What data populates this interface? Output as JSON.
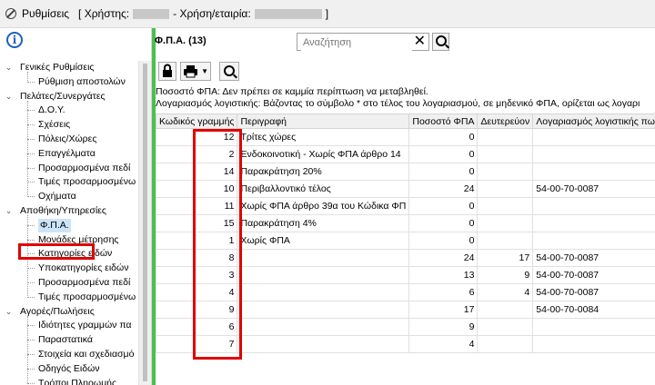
{
  "window": {
    "title": "Ρυθμίσεις",
    "user_label": "[ Χρήστης:",
    "company_label": "- Χρήση/εταιρία:",
    "close_bracket": "]"
  },
  "tree": {
    "groups": [
      {
        "label": "Γενικές Ρυθμίσεις",
        "children": [
          "Ρύθμιση αποστολών"
        ]
      },
      {
        "label": "Πελάτες/Συνεργάτες",
        "children": [
          "Δ.Ο.Υ.",
          "Σχέσεις",
          "Πόλεις/Χώρες",
          "Επαγγέλματα",
          "Προσαρμοσμένα πεδί",
          "Τιμές προσαρμοσμένω",
          "Οχήματα"
        ]
      },
      {
        "label": "Αποθήκη/Υπηρεσίες",
        "children": [
          "Φ.Π.Α.",
          "Μονάδες μέτρησης",
          "Κατηγορίες ειδών",
          "Υποκατηγορίες ειδών",
          "Προσαρμοσμένα πεδί",
          "Τιμές προσαρμοσμένω"
        ]
      },
      {
        "label": "Αγορές/Πωλήσεις",
        "children": [
          "Ιδιότητες γραμμών πα",
          "Παραστατικά",
          "Στοιχεία και σχεδιασμό",
          "Οδηγός Ειδών",
          "Τρόποι Πληρωμής"
        ]
      }
    ],
    "selected": "Φ.Π.Α."
  },
  "main": {
    "heading": "Φ.Π.Α. (13)",
    "search_placeholder": "Αναζήτηση",
    "notes": [
      "Ποσοστό ΦΠΑ: Δεν πρέπει σε καμμία περίπτωση να μεταβληθεί.",
      "Λογαριασμός λογιστικής: Βάζοντας το σύμβολο * στο τέλος του λογαριασμού, σε μηδενικό ΦΠΑ, ορίζεται ως λογαρι"
    ],
    "columns": [
      "Κωδικός γραμμής",
      "Περιγραφή",
      "Ποσοστό ΦΠΑ",
      "Δευτερεύον",
      "Λογαριασμός λογιστικής πω"
    ],
    "rows": [
      {
        "code": "12",
        "desc": "Τρίτες χώρες",
        "pct": "0",
        "sec": "",
        "acct": ""
      },
      {
        "code": "2",
        "desc": "Ενδοκοινοτική - Χωρίς ΦΠΑ άρθρο 14",
        "pct": "0",
        "sec": "",
        "acct": ""
      },
      {
        "code": "14",
        "desc": "Παρακράτηση 20%",
        "pct": "0",
        "sec": "",
        "acct": ""
      },
      {
        "code": "10",
        "desc": "Περιβαλλοντικό τέλος",
        "pct": "24",
        "sec": "",
        "acct": "54-00-70-0087"
      },
      {
        "code": "11",
        "desc": "Χωρίς ΦΠΑ άρθρο 39α του Κώδικα ΦΠ",
        "pct": "0",
        "sec": "",
        "acct": ""
      },
      {
        "code": "15",
        "desc": "Παρακράτηση 4%",
        "pct": "0",
        "sec": "",
        "acct": ""
      },
      {
        "code": "1",
        "desc": "Χωρίς ΦΠΑ",
        "pct": "0",
        "sec": "",
        "acct": ""
      },
      {
        "code": "8",
        "desc": "",
        "pct": "24",
        "sec": "17",
        "acct": "54-00-70-0087"
      },
      {
        "code": "3",
        "desc": "",
        "pct": "13",
        "sec": "9",
        "acct": "54-00-70-0087"
      },
      {
        "code": "4",
        "desc": "",
        "pct": "6",
        "sec": "4",
        "acct": "54-00-70-0087"
      },
      {
        "code": "9",
        "desc": "",
        "pct": "17",
        "sec": "",
        "acct": "54-00-70-0084"
      },
      {
        "code": "6",
        "desc": "",
        "pct": "9",
        "sec": "",
        "acct": ""
      },
      {
        "code": "7",
        "desc": "",
        "pct": "4",
        "sec": "",
        "acct": ""
      }
    ]
  },
  "icons": [
    "info-icon",
    "lock-icon",
    "print-icon",
    "search-icon",
    "clear-icon"
  ],
  "colors": {
    "highlight": "#e00000",
    "accent_green": "#4cc04c",
    "selection": "#cce4f7",
    "info_blue": "#1f5fbf"
  }
}
